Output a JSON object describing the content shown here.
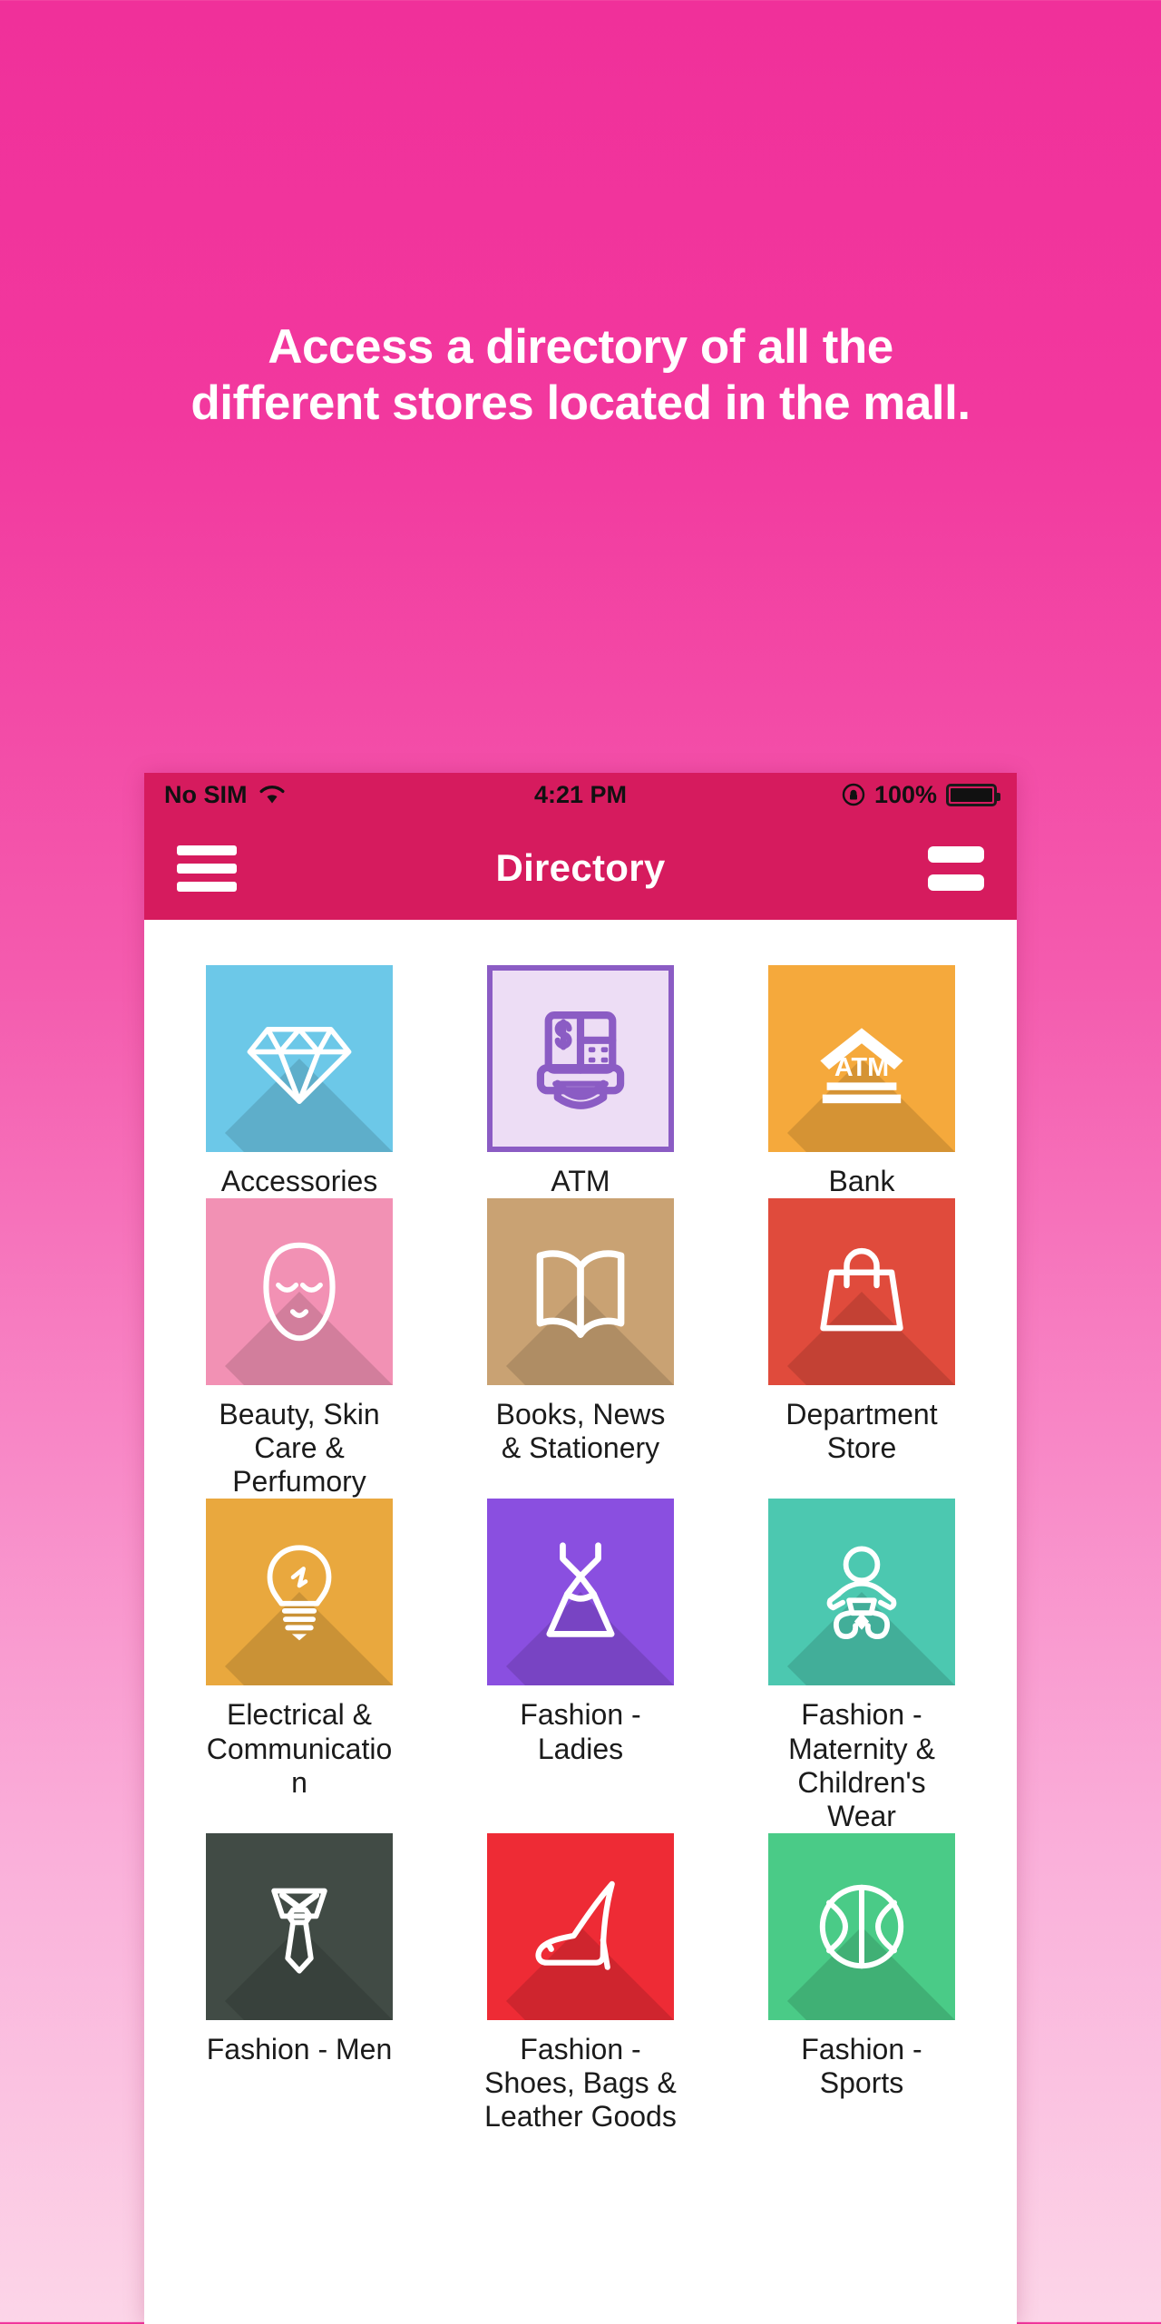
{
  "headline": {
    "line1": "Access a directory of all the",
    "line2": "different stores located in the mall."
  },
  "statusbar": {
    "carrier": "No SIM",
    "wifi_icon": "wifi-icon",
    "time": "4:21 PM",
    "rotation_lock_icon": "rotation-lock-icon",
    "battery_percent": "100%",
    "battery_icon": "battery-icon"
  },
  "navbar": {
    "menu_icon": "hamburger-menu-icon",
    "title": "Directory",
    "list_icon": "list-view-icon"
  },
  "colors": {
    "brand_pink": "#D61B5E",
    "background_top": "#F0309A",
    "background_bottom": "#FCD5E8",
    "accent_purple": "#8B5CC4"
  },
  "grid": {
    "items": [
      {
        "label": "Accessories",
        "icon": "diamond-icon",
        "bg": "#6CC8E8",
        "fg": "#FFFFFF",
        "bordered": false
      },
      {
        "label": "ATM",
        "icon": "atm-machine-icon",
        "bg": "#EDDDF5",
        "fg": "#8B5CC4",
        "bordered": true
      },
      {
        "label": "Bank",
        "icon": "bank-building-icon",
        "bg": "#F5A93C",
        "fg": "#FFFFFF",
        "bordered": false
      },
      {
        "label": "Beauty, Skin Care & Perfumory",
        "icon": "face-icon",
        "bg": "#F291B4",
        "fg": "#FFFFFF",
        "bordered": false
      },
      {
        "label": "Books, News & Stationery",
        "icon": "open-book-icon",
        "bg": "#C9A273",
        "fg": "#FFFFFF",
        "bordered": false
      },
      {
        "label": "Department Store",
        "icon": "shopping-bag-icon",
        "bg": "#E04B3C",
        "fg": "#FFFFFF",
        "bordered": false
      },
      {
        "label": "Electrical & Communication",
        "icon": "lightbulb-icon",
        "bg": "#E9A83E",
        "fg": "#FFFFFF",
        "bordered": false
      },
      {
        "label": "Fashion - Ladies",
        "icon": "dress-icon",
        "bg": "#8A4FE0",
        "fg": "#FFFFFF",
        "bordered": false
      },
      {
        "label": "Fashion - Maternity & Children's Wear",
        "icon": "baby-icon",
        "bg": "#4CC8B0",
        "fg": "#FFFFFF",
        "bordered": false
      },
      {
        "label": "Fashion - Men",
        "icon": "necktie-icon",
        "bg": "#414B45",
        "fg": "#FFFFFF",
        "bordered": false
      },
      {
        "label": "Fashion - Shoes, Bags & Leather Goods",
        "icon": "high-heel-shoe-icon",
        "bg": "#EE2B35",
        "fg": "#FFFFFF",
        "bordered": false
      },
      {
        "label": "Fashion - Sports",
        "icon": "basketball-icon",
        "bg": "#4ACB87",
        "fg": "#FFFFFF",
        "bordered": false
      }
    ]
  }
}
